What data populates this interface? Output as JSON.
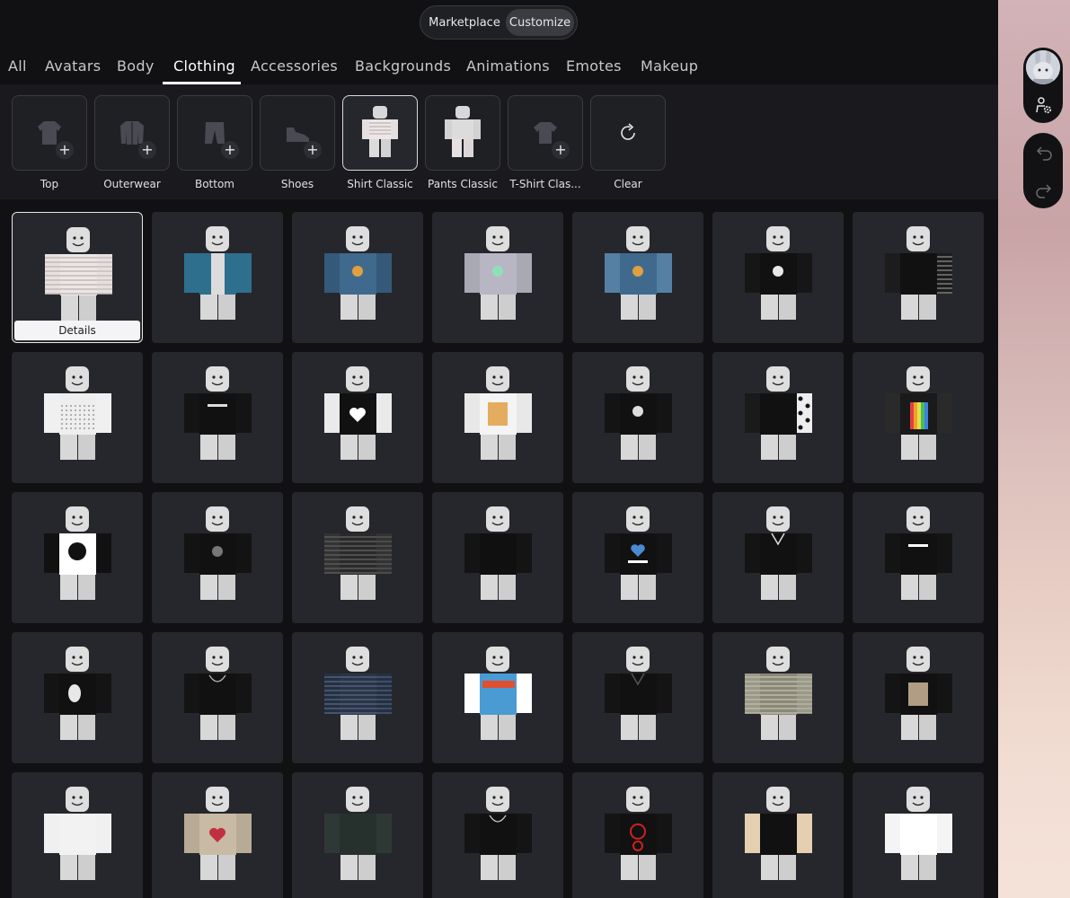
{
  "mode_toggle": {
    "marketplace": "Marketplace",
    "customize": "Customize",
    "active": "Customize"
  },
  "tabs": [
    "All",
    "Avatars",
    "Body",
    "Clothing",
    "Accessories",
    "Backgrounds",
    "Animations",
    "Emotes",
    "Makeup"
  ],
  "active_tab": "Clothing",
  "categories": [
    {
      "label": "Top",
      "icon": "shirt-icon",
      "empty": true
    },
    {
      "label": "Outerwear",
      "icon": "jacket-icon",
      "empty": true
    },
    {
      "label": "Bottom",
      "icon": "pants-icon",
      "empty": true
    },
    {
      "label": "Shoes",
      "icon": "shoe-icon",
      "empty": true
    },
    {
      "label": "Shirt Classic",
      "icon": "avatar-thumbnail",
      "empty": false,
      "selected": true
    },
    {
      "label": "Pants Classic",
      "icon": "avatar-thumbnail",
      "empty": false
    },
    {
      "label": "T-Shirt Clas...",
      "icon": "tshirt-icon",
      "empty": true
    },
    {
      "label": "Clear",
      "icon": "refresh-icon",
      "empty": false
    }
  ],
  "details_label": "Details",
  "grid": [
    {
      "body": "#ece7e6",
      "arms": "#e6e0df",
      "pattern": "stripes",
      "detail": "#c9bebe",
      "selected": true
    },
    {
      "body": "#dcdcdc",
      "arms": "#2f6f8e",
      "pattern": "jacket",
      "detail": "#245a75"
    },
    {
      "body": "#3f6a8e",
      "arms": "#35597a",
      "pattern": "logo",
      "detail": "#e0a040"
    },
    {
      "body": "#b8b6c4",
      "arms": "#a9a9b4",
      "pattern": "logo",
      "detail": "#8fe0b8"
    },
    {
      "body": "#3f6a8e",
      "arms": "#5580a4",
      "pattern": "logo",
      "detail": "#e0a040"
    },
    {
      "body": "#111111",
      "arms": "#161616",
      "pattern": "logo",
      "detail": "#e8e8e8"
    },
    {
      "body": "#111111",
      "arms": "#1c1c1c",
      "pattern": "plaid",
      "detail": "#7a7a7a"
    },
    {
      "body": "#eeeeee",
      "arms": "#f0f0f0",
      "pattern": "dots",
      "detail": "#9a9a9a"
    },
    {
      "body": "#111111",
      "arms": "#141414",
      "pattern": "text",
      "detail": "#dddddd"
    },
    {
      "body": "#111111",
      "arms": "#eaeaea",
      "pattern": "heart",
      "detail": "#ffffff"
    },
    {
      "body": "#f4f4f4",
      "arms": "#e8e8e8",
      "pattern": "anime",
      "detail": "#e09a3a"
    },
    {
      "body": "#111111",
      "arms": "#141414",
      "pattern": "logo",
      "detail": "#dddddd"
    },
    {
      "body": "#111111",
      "arms": "#1a1a1a",
      "pattern": "cow",
      "detail": "#eeeeee"
    },
    {
      "body": "#1a1a1a",
      "arms": "#2a2a2a",
      "pattern": "rainbow",
      "detail": "#f0a030"
    },
    {
      "body": "#ffffff",
      "arms": "#111111",
      "pattern": "circle-logo",
      "detail": "#111111"
    },
    {
      "body": "#111111",
      "arms": "#131313",
      "pattern": "logo",
      "detail": "#777777"
    },
    {
      "body": "#2a2a2a",
      "arms": "#333333",
      "pattern": "stripes",
      "detail": "#555555"
    },
    {
      "body": "#101010",
      "arms": "#141414",
      "pattern": "plain",
      "detail": "#444444"
    },
    {
      "body": "#111111",
      "arms": "#141414",
      "pattern": "israel",
      "detail": "#ffffff"
    },
    {
      "body": "#111111",
      "arms": "#141414",
      "pattern": "suit",
      "detail": "#dddddd"
    },
    {
      "body": "#111111",
      "arms": "#141414",
      "pattern": "text",
      "detail": "#ffffff"
    },
    {
      "body": "#111111",
      "arms": "#141414",
      "pattern": "ghost",
      "detail": "#e8e8e8"
    },
    {
      "body": "#111111",
      "arms": "#141414",
      "pattern": "chain",
      "detail": "#bbbbbb"
    },
    {
      "body": "#2a3446",
      "arms": "#243040",
      "pattern": "stripes",
      "detail": "#4a5a74"
    },
    {
      "body": "#4a9bd4",
      "arms": "#ffffff",
      "pattern": "banner",
      "detail": "#e05030"
    },
    {
      "body": "#111111",
      "arms": "#141414",
      "pattern": "suit",
      "detail": "#555555"
    },
    {
      "body": "#8a8878",
      "arms": "#9a9888",
      "pattern": "stripes",
      "detail": "#b8b4a4"
    },
    {
      "body": "#111111",
      "arms": "#141414",
      "pattern": "anime",
      "detail": "#d8c0a0"
    },
    {
      "body": "#f2f2f2",
      "arms": "#f0f0f0",
      "pattern": "plain",
      "detail": "#dddddd"
    },
    {
      "body": "#c8baa4",
      "arms": "#b8ab96",
      "pattern": "heart",
      "detail": "#c03040"
    },
    {
      "body": "#26302c",
      "arms": "#2e3834",
      "pattern": "plain",
      "detail": "#3e4a44"
    },
    {
      "body": "#111111",
      "arms": "#141414",
      "pattern": "chain",
      "detail": "#cccccc"
    },
    {
      "body": "#111111",
      "arms": "#141414",
      "pattern": "sigil",
      "detail": "#d02020"
    },
    {
      "body": "#111111",
      "arms": "#e4d0b0",
      "pattern": "plain",
      "detail": "#e4d0b0"
    },
    {
      "body": "#ffffff",
      "arms": "#f4f4f4",
      "pattern": "plain",
      "detail": "#dddddd"
    }
  ]
}
